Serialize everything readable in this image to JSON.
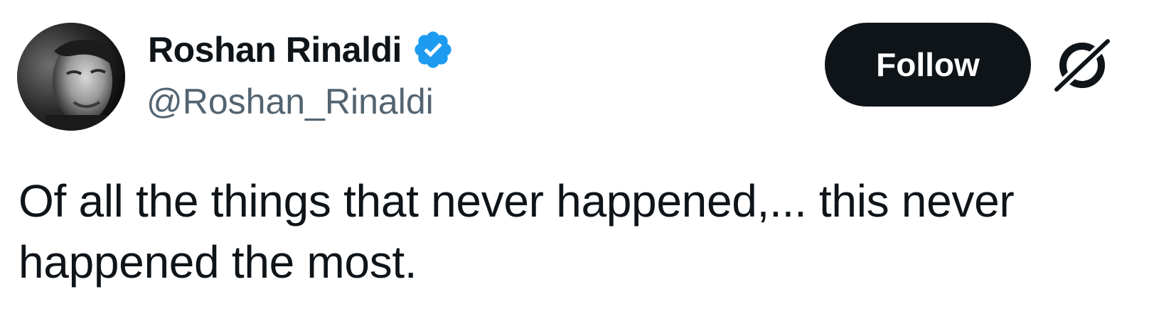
{
  "author": {
    "display_name": "Roshan Rinaldi",
    "handle": "@Roshan_Rinaldi",
    "verified": true,
    "verified_color": "#1d9bf0",
    "avatar_icon": "profile-photo"
  },
  "actions": {
    "follow_label": "Follow",
    "menu_icon": "grok-icon"
  },
  "tweet": {
    "text": "Of all the things that never happened,... this never happened the most."
  },
  "colors": {
    "text_primary": "#0f1419",
    "text_secondary": "#536471",
    "button_bg": "#0f1419",
    "button_text": "#ffffff"
  }
}
